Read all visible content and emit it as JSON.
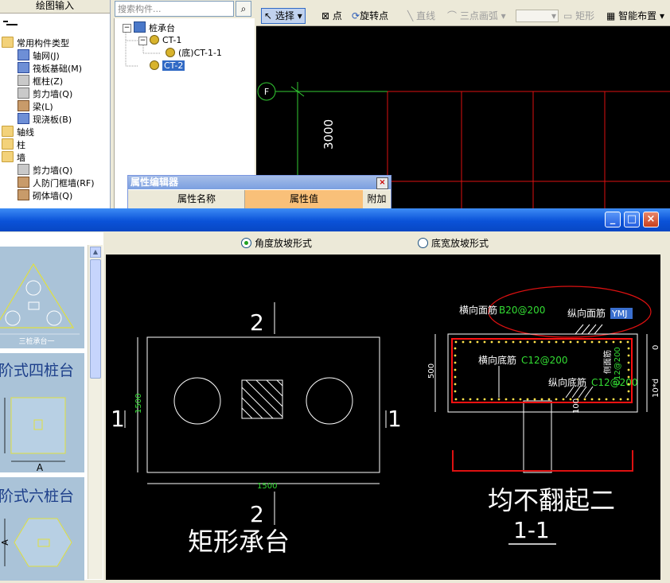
{
  "left_panel": {
    "title": "绘图输入",
    "items": [
      {
        "label": "常用构件类型",
        "icon": "folder-open-icon"
      },
      {
        "label": "轴网(J)",
        "icon": "grid-icon"
      },
      {
        "label": "筏板基础(M)",
        "icon": "raft-icon"
      },
      {
        "label": "框柱(Z)",
        "icon": "column-icon"
      },
      {
        "label": "剪力墙(Q)",
        "icon": "shear-wall-icon"
      },
      {
        "label": "梁(L)",
        "icon": "beam-icon"
      },
      {
        "label": "现浇板(B)",
        "icon": "slab-icon"
      },
      {
        "label": "轴线",
        "icon": "folder-icon"
      },
      {
        "label": "柱",
        "icon": "folder-icon"
      },
      {
        "label": "墙",
        "icon": "folder-open-icon"
      },
      {
        "label": "剪力墙(Q)",
        "icon": "shear-wall-icon"
      },
      {
        "label": "人防门框墙(RF)",
        "icon": "door-wall-icon"
      },
      {
        "label": "砌体墙(Q)",
        "icon": "masonry-wall-icon"
      }
    ]
  },
  "search": {
    "placeholder": "搜索构件..."
  },
  "tree": {
    "root": "桩承台",
    "child1": "CT-1",
    "grandchild": "(底)CT-1-1",
    "child2": "CT-2"
  },
  "toolbar": {
    "select": "选择",
    "point": "点",
    "rotate_point": "旋转点",
    "line": "直线",
    "arc": "三点画弧",
    "rect": "矩形",
    "smart": "智能布置"
  },
  "cad": {
    "axis_label": "F",
    "dim": "3000"
  },
  "prop_editor": {
    "title": "属性编辑器",
    "col_name": "属性名称",
    "col_value": "属性值",
    "col_extra": "附加"
  },
  "thumbnails": {
    "t1_label": "三桩承台一",
    "t2_label": "阶式四桩台",
    "t2_dim": "A",
    "t3_label": "阶式六桩台",
    "t3_dim": "A"
  },
  "radio": {
    "opt1": "角度放坡形式",
    "opt2": "底宽放坡形式"
  },
  "plan": {
    "top_mark": "2",
    "bottom_mark": "2",
    "left_mark": "1",
    "right_mark": "1",
    "width_dim": "1500",
    "height_dim": "1500",
    "caption": "矩形承台"
  },
  "section": {
    "top_bar_label": "横向面筋",
    "top_bar_value": "B20@200",
    "long_top_label": "纵向面筋",
    "long_top_value": "YMJ",
    "bottom_bar_label": "横向底筋",
    "bottom_bar_value": "C12@200",
    "long_bottom_label": "纵向底筋",
    "long_bottom_value": "C12@200",
    "side_label": "侧面筋",
    "side_value": "C12@200",
    "dim_height": "500",
    "dim_zero": "0",
    "dim_10d": "10*d",
    "dim_100": "100",
    "note": "均不翻起二",
    "caption": "1-1"
  },
  "colors": {
    "green": "#33dd33",
    "red": "#dd1111",
    "white": "#ffffff",
    "highlight": "#316ac5"
  }
}
